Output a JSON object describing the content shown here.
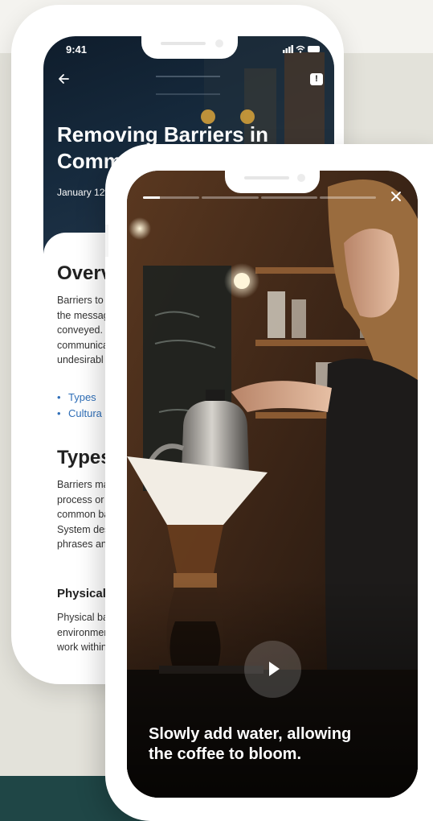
{
  "status_bar": {
    "time": "9:41"
  },
  "article": {
    "title_lines": [
      "Removing Barriers in",
      "Commu"
    ],
    "date": "January 12th",
    "overview_heading": "Overvi",
    "overview_lines": [
      "Barriers to",
      "the messag",
      "conveyed.",
      "communica",
      "undesirabl"
    ],
    "bullets": [
      "Types",
      "Cultura"
    ],
    "types_heading": "Types",
    "types_lines": [
      "Barriers ma",
      "process or c",
      "common ba",
      "System des",
      "phrases and"
    ],
    "physical_heading": "Physical",
    "physical_lines": [
      "Physical ba",
      "environmen",
      "work within"
    ]
  },
  "story": {
    "progress": {
      "segments": 4,
      "active_fraction": 0.3
    },
    "caption_lines": [
      "Slowly add water, allowing",
      "the coffee to bloom."
    ]
  },
  "colors": {
    "page_background": "#e3e2da",
    "page_bottom_band": "#1f4646",
    "link_blue": "#2f6fb8"
  },
  "icons": {
    "back": "back-arrow-icon",
    "report": "report-icon",
    "close": "close-icon",
    "play": "play-icon"
  }
}
